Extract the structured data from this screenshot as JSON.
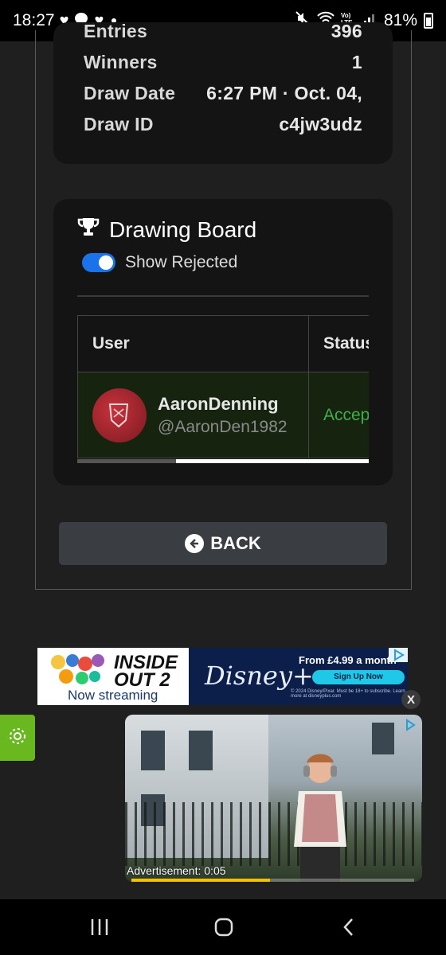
{
  "status_bar": {
    "time": "18:27",
    "battery": "81%",
    "icons": [
      "heart-icon",
      "chat-bubble-icon",
      "heart-icon",
      "dot-icon",
      "mute-icon",
      "wifi-icon",
      "volte-icon",
      "signal-icon",
      "battery-icon"
    ]
  },
  "stats": {
    "rows": [
      {
        "label": "Entries",
        "value": "396"
      },
      {
        "label": "Winners",
        "value": "1"
      },
      {
        "label": "Draw Date",
        "value": "6:27 PM · Oct. 04,"
      },
      {
        "label": "Draw ID",
        "value": "c4jw3udz"
      }
    ]
  },
  "board": {
    "title": "Drawing Board",
    "toggle_label": "Show Rejected",
    "toggle_on": true,
    "columns": [
      "User",
      "Status"
    ],
    "rows": [
      {
        "name": "AaronDenning",
        "handle": "@AaronDen1982",
        "status": "Accepted"
      }
    ],
    "scroll_fraction": 0.34
  },
  "back_button": {
    "label": "BACK"
  },
  "banner_ad": {
    "title_line": "INSIDE OUT 2",
    "subtitle": "Now streaming",
    "brand": "Disney+",
    "price": "From £4.99 a month",
    "cta": "Sign Up Now",
    "fine_print": "© 2024 Disney/Pixar. Must be 18+ to subscribe. Learn more at disneyplus.com",
    "close": "X"
  },
  "video_ad": {
    "label": "Advertisement: 0:05",
    "progress": 0.49
  },
  "colors": {
    "accent_blue": "#1a73e8",
    "status_green": "#3fae4a",
    "side_tab_green": "#6ab820",
    "progress_yellow": "#f2c200"
  }
}
